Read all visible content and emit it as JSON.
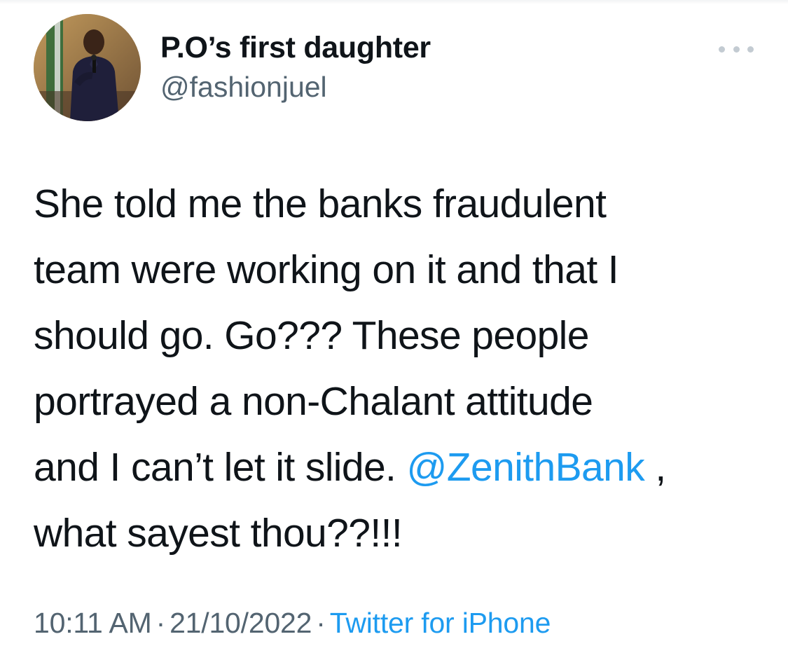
{
  "author": {
    "display_name": "P.O’s first daughter",
    "handle": "@fashionjuel"
  },
  "more_icon": "more-horizontal-icon",
  "tweet": {
    "line1": "She told me the banks fraudulent",
    "line2": "team were working on it and that I",
    "line3": "should go. Go??? These people",
    "line4": "portrayed a non-Chalant attitude",
    "line5_before": "and I can’t let it slide. ",
    "mention": "@ZenithBank",
    "line5_after": " ,",
    "line6": "what sayest thou??!!!"
  },
  "meta": {
    "time": "10:11 AM",
    "separator": "·",
    "date": "21/10/2022",
    "source": "Twitter for iPhone"
  },
  "colors": {
    "link": "#1d9bf0",
    "secondary_text": "#536471",
    "primary_text": "#0f1419"
  }
}
